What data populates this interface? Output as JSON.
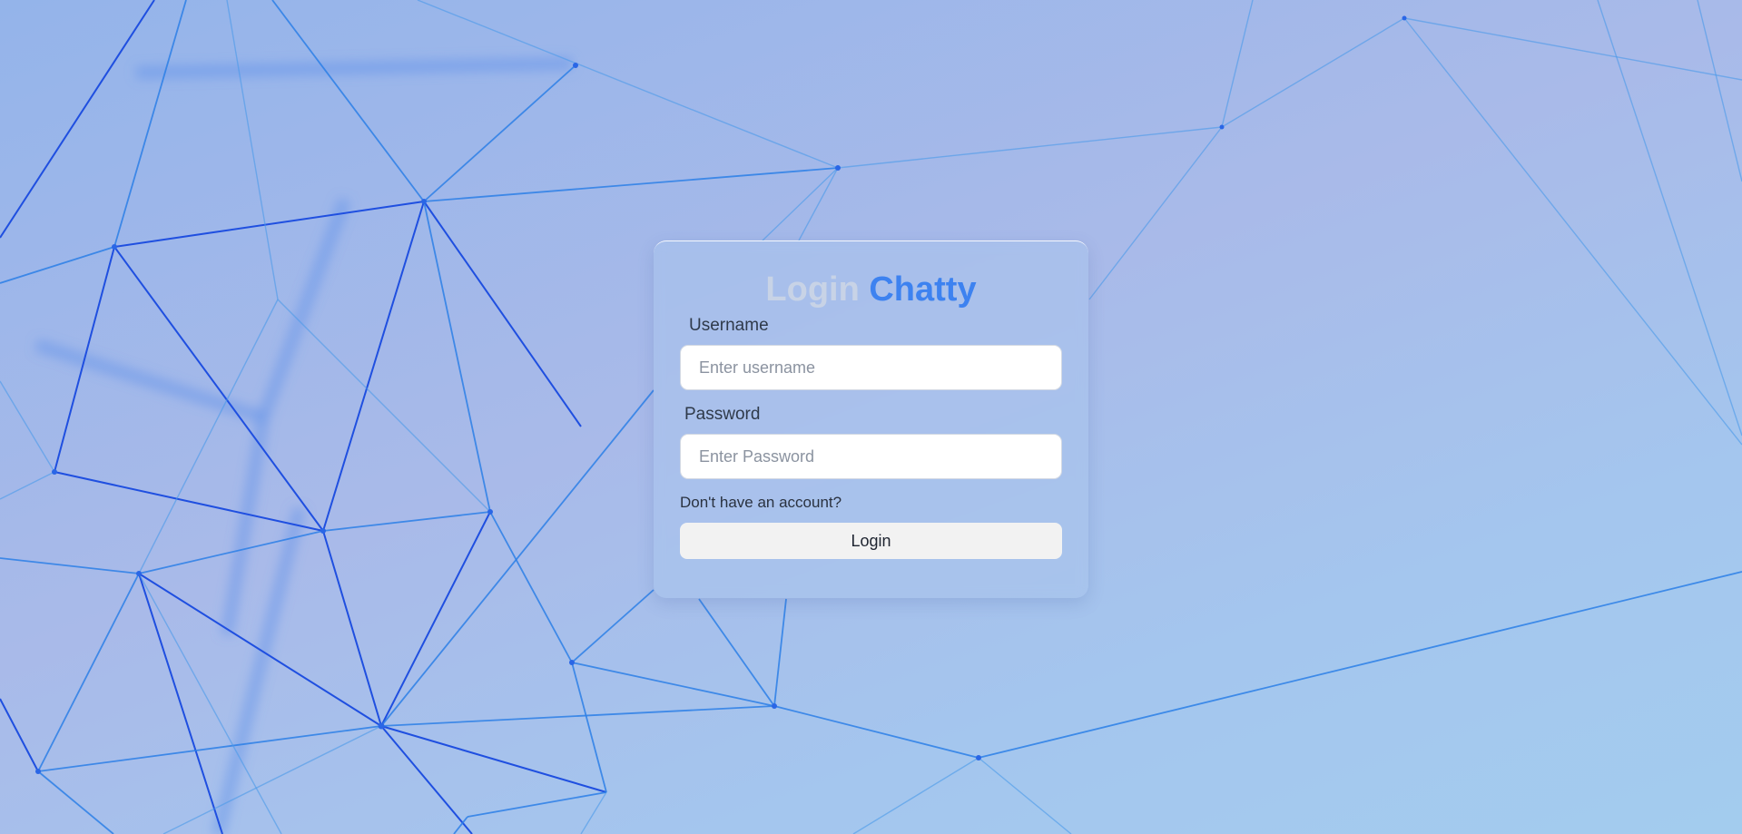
{
  "login_form": {
    "title_word_1": "Login",
    "title_word_2": "Chatty",
    "username_label": "Username",
    "username_placeholder": "Enter username",
    "username_value": "",
    "password_label": "Password",
    "password_placeholder": "Enter Password",
    "password_value": "",
    "signup_link": "Don't have an account?",
    "submit_label": "Login"
  },
  "colors": {
    "title_muted": "#c8d3e6",
    "title_accent": "#3d82f0",
    "background_start": "#94b4ea",
    "background_end": "#a3ccee"
  }
}
